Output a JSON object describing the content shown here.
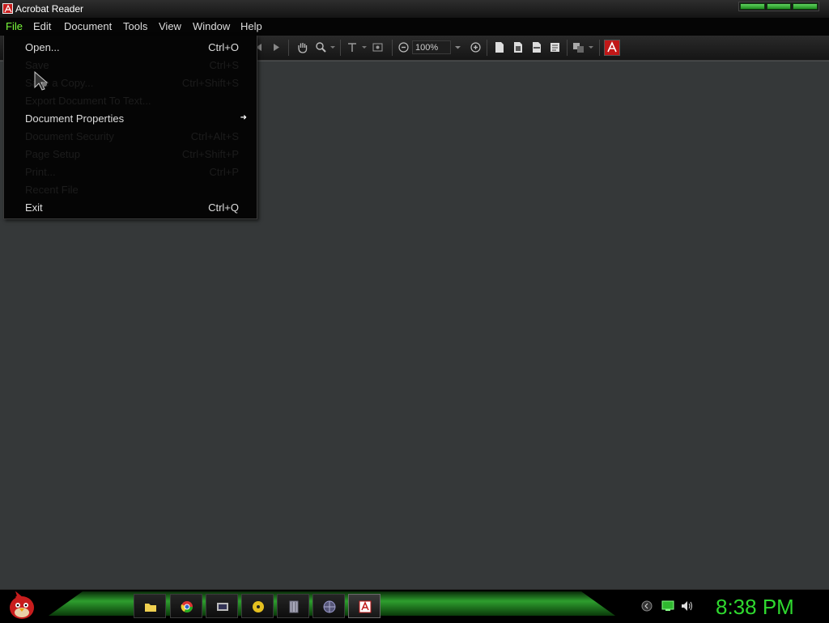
{
  "window": {
    "title": "Acrobat Reader"
  },
  "menubar": {
    "items": [
      "File",
      "Edit",
      "Document",
      "Tools",
      "View",
      "Window",
      "Help"
    ],
    "active": "File"
  },
  "toolbar": {
    "zoom_value": "100%"
  },
  "file_menu": {
    "items": [
      {
        "label": "Open...",
        "shortcut": "Ctrl+O",
        "enabled": true
      },
      {
        "label": "Save",
        "shortcut": "Ctrl+S",
        "enabled": false
      },
      {
        "label": "Save a Copy...",
        "shortcut": "Ctrl+Shift+S",
        "enabled": false
      },
      {
        "label": "Export Document To Text...",
        "shortcut": "",
        "enabled": false
      },
      {
        "label": "Document Properties",
        "shortcut": "",
        "enabled": true,
        "submenu": true
      },
      {
        "label": "Document Security",
        "shortcut": "Ctrl+Alt+S",
        "enabled": false
      },
      {
        "label": "Page Setup",
        "shortcut": "Ctrl+Shift+P",
        "enabled": false
      },
      {
        "label": "Print...",
        "shortcut": "Ctrl+P",
        "enabled": false
      },
      {
        "label": "Recent File",
        "shortcut": "",
        "enabled": false
      },
      {
        "label": "Exit",
        "shortcut": "Ctrl+Q",
        "enabled": true
      }
    ]
  },
  "taskbar": {
    "clock": "8:38 PM",
    "buttons": [
      "folder-icon",
      "chrome-icon",
      "media-player-icon",
      "disc-icon",
      "file-cabinet-icon",
      "globe-icon",
      "acrobat-icon"
    ],
    "active_button": "acrobat-icon"
  },
  "colors": {
    "accent": "#2fd92f",
    "menu_active": "#7cfc3c",
    "doc_bg": "#353839"
  }
}
